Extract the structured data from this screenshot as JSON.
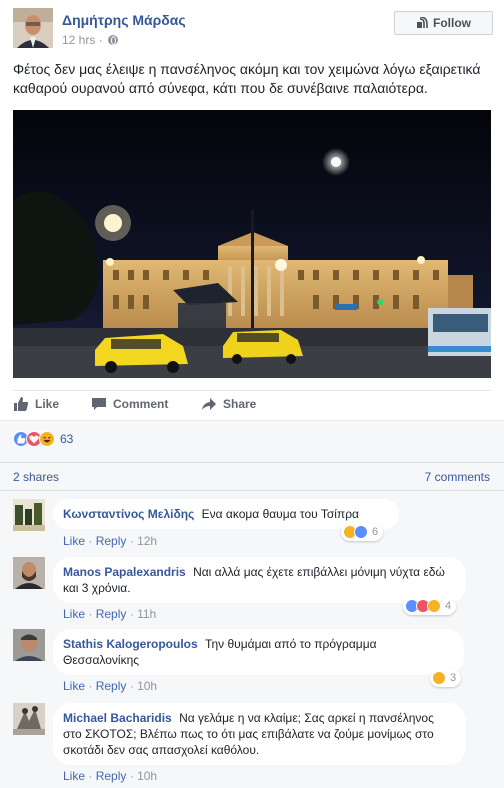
{
  "post": {
    "author": "Δημήτρης Μάρδας",
    "time": "12 hrs",
    "follow_label": "Follow",
    "text": "Φέτος δεν μας έλειψε η πανσέληνος ακόμη και τον χειμώνα λόγω εξαιρετικά καθαρού ουρανού από σύνεφα, κάτι που δε συνέβαινε παλαιότερα."
  },
  "actions": {
    "like": "Like",
    "comment": "Comment",
    "share": "Share"
  },
  "reactions": {
    "count": "63",
    "icons": [
      "like-icon",
      "love-icon",
      "haha-icon"
    ]
  },
  "stats": {
    "shares": "2 shares",
    "comments": "7 comments"
  },
  "comments": [
    {
      "name": "Κωνσταντίνος Μελίδης",
      "text": "Ενα ακομα θαυμα του Τσίπρα",
      "like": "Like",
      "reply": "Reply",
      "time": "12h",
      "reactions": "6"
    },
    {
      "name": "Manos Papalexandris",
      "text": "Ναι αλλά μας έχετε επιβάλλει μόνιμη νύχτα εδώ και 3 χρόνια.",
      "like": "Like",
      "reply": "Reply",
      "time": "11h",
      "reactions": "4"
    },
    {
      "name": "Stathis Kalogeropoulos",
      "text": "Την θυμάμαι από το πρόγραμμα Θεσσαλονίκης",
      "like": "Like",
      "reply": "Reply",
      "time": "10h",
      "reactions": "3"
    },
    {
      "name": "Michael Bacharidis",
      "text": "Να γελάμε η να κλαίμε; Σας αρκεί η πανσέληνος στο ΣΚΟΤΟΣ; Βλέπω πως το ότι μας επιβάλατε να ζούμε μονίμως στο σκοτάδι δεν σας απασχολεί καθόλου.",
      "like": "Like",
      "reply": "Reply",
      "time": "10h"
    }
  ]
}
